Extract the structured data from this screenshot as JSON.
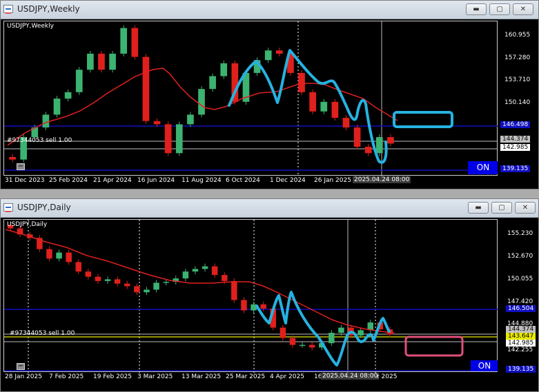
{
  "weekly": {
    "title": "USDJPY,Weekly",
    "symbol_label": "USDJPY,Weekly",
    "order_label": "#97344053 sell 1.00",
    "on_label": "ON",
    "price_ticks": [
      "160.955",
      "157.280",
      "153.710",
      "150.140",
      "146.498",
      "144.374",
      "142.985",
      "139.135"
    ],
    "date_ticks": [
      "31 Dec 2023",
      "25 Feb 2024",
      "21 Apr 2024",
      "16 Jun 2024",
      "11 Aug 2024",
      "6 Oct 2024",
      "1 Dec 2024",
      "26 Jan 2025",
      "2025.04.24 08:00"
    ]
  },
  "daily": {
    "title": "USDJPY,Daily",
    "symbol_label": "USDJPY,Daily",
    "order_label": "#97344053 sell 1.00",
    "on_label": "ON",
    "price_ticks": [
      "155.230",
      "152.670",
      "150.055",
      "147.420",
      "146.504",
      "144.880",
      "144.374",
      "143.647",
      "142.985",
      "142.255",
      "139.135"
    ],
    "date_ticks": [
      "28 Jan 2025",
      "7 Feb 2025",
      "19 Feb 2025",
      "3 Mar 2025",
      "13 Mar 2025",
      "25 Mar 2025",
      "4 Apr 2025",
      "16",
      "2025.04.24 08:00",
      "r 2025"
    ]
  },
  "colors": {
    "bull": "#3cb371",
    "bear": "#e0201c",
    "ma": "#e02020",
    "hline_blue": "#1010c0",
    "highlight_cyan": "#26b2e0",
    "highlight_pink": "#e0507a"
  },
  "chart_data": [
    {
      "type": "line",
      "title": "USDJPY,Weekly",
      "series": [
        {
          "name": "",
          "values": [
            141.0,
            144.5,
            146.0,
            148.0,
            150.5,
            151.5,
            155.0,
            157.5,
            155.0,
            157.5,
            161.5,
            157.0,
            147.0,
            146.5,
            142.0,
            146.5,
            148.0,
            152.0,
            154.0,
            156.0,
            150.0,
            154.5,
            156.5,
            158.0,
            157.5,
            154.5,
            151.5,
            148.5,
            150.0,
            147.5,
            146.0,
            143.0,
            142.0,
            144.5,
            143.5
          ]
        }
      ],
      "ylim": [
        139.135,
        162.0
      ]
    },
    {
      "type": "line",
      "title": "USDJPY,Daily",
      "series": [
        {
          "name": "",
          "values": [
            155.3,
            154.6,
            154.2,
            152.9,
            151.8,
            152.5,
            151.4,
            150.3,
            149.7,
            149.2,
            149.4,
            148.9,
            148.6,
            147.9,
            148.2,
            149.0,
            149.1,
            149.5,
            150.3,
            150.6,
            150.9,
            149.9,
            149.2,
            147.0,
            145.8,
            146.5,
            146.0,
            143.8,
            142.6,
            141.8,
            141.8,
            141.5,
            142.0,
            143.2,
            143.8,
            142.9,
            143.5,
            144.4,
            143.6,
            143.0
          ]
        }
      ],
      "ylim": [
        139.135,
        155.9
      ]
    }
  ]
}
